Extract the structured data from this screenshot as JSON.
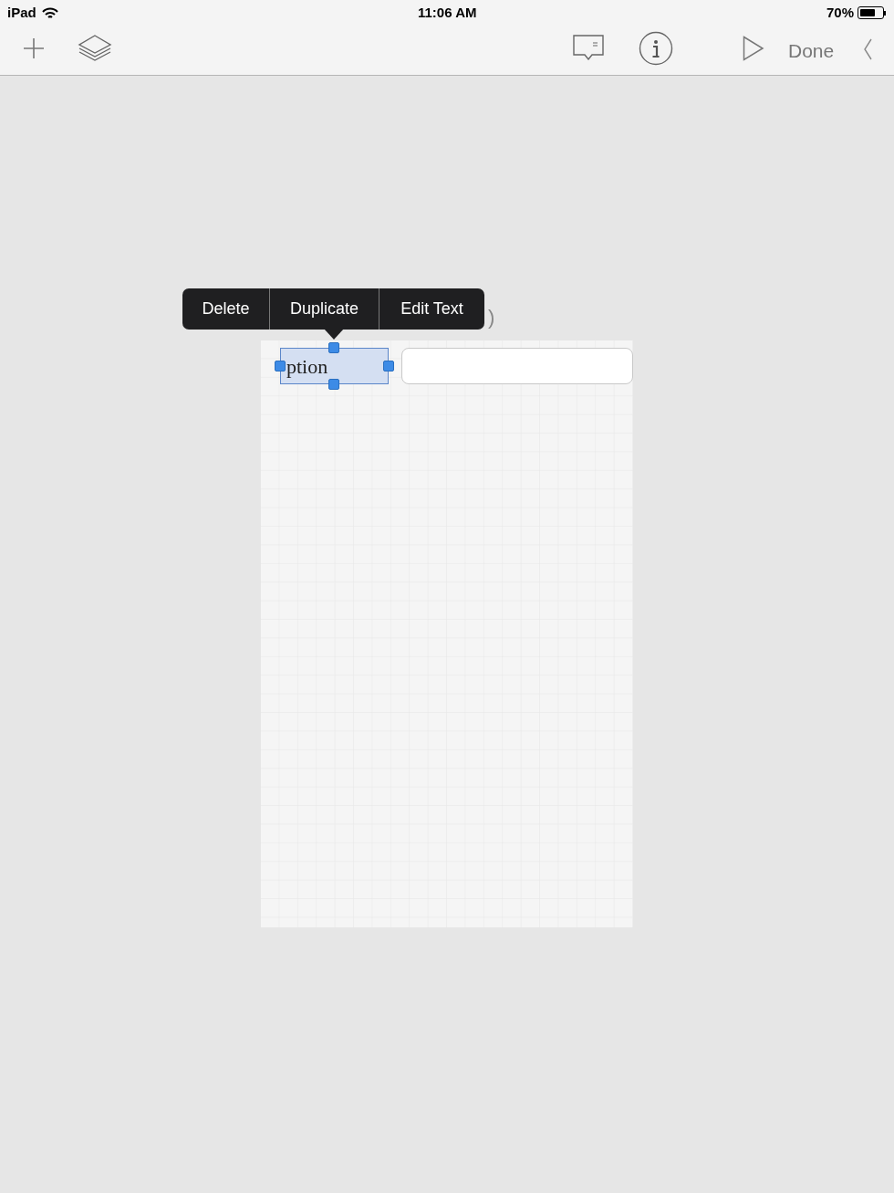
{
  "status_bar": {
    "device": "iPad",
    "time": "11:06 AM",
    "battery": "70%"
  },
  "toolbar": {
    "done": "Done"
  },
  "context_menu": {
    "items": [
      "Delete",
      "Duplicate",
      "Edit Text"
    ]
  },
  "covered_label": {
    "text": ")"
  },
  "canvas": {
    "elements": [
      {
        "kind": "label",
        "text": "ption",
        "selected": true
      },
      {
        "kind": "text_field",
        "selected": false
      }
    ]
  }
}
